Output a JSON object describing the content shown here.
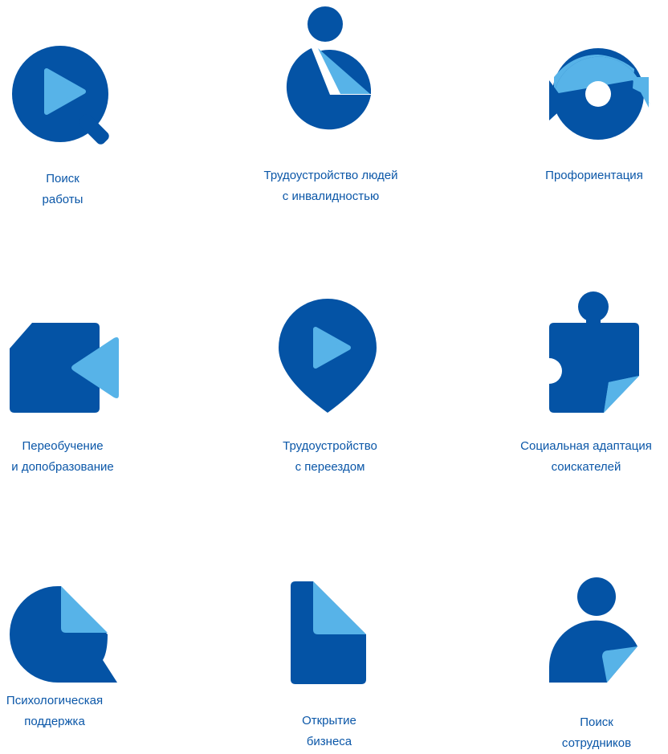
{
  "colors": {
    "primary": "#0453a5",
    "accent": "#57b3e8",
    "label_text": "#0b57a8"
  },
  "services": [
    {
      "id": "job-search",
      "icon": "play-magnifier-icon",
      "label_lines": [
        "Поиск",
        "работы"
      ]
    },
    {
      "id": "disability-employment",
      "icon": "person-pie-icon",
      "label_lines": [
        "Трудоустройство людей",
        "с инвалидностью"
      ]
    },
    {
      "id": "career-guidance",
      "icon": "refresh-cycle-icon",
      "label_lines": [
        "Профориентация"
      ]
    },
    {
      "id": "retraining",
      "icon": "video-camera-icon",
      "label_lines": [
        "Переобучение",
        "и допобразование"
      ]
    },
    {
      "id": "relocation-employment",
      "icon": "location-pin-play-icon",
      "label_lines": [
        "Трудоустройство",
        "с переездом"
      ]
    },
    {
      "id": "social-adaptation",
      "icon": "puzzle-piece-icon",
      "label_lines": [
        "Социальная адаптация",
        "соискателей"
      ]
    },
    {
      "id": "psychological-support",
      "icon": "speech-bubble-icon",
      "label_lines": [
        "Психологическая",
        "поддержка"
      ]
    },
    {
      "id": "business-opening",
      "icon": "document-icon",
      "label_lines": [
        "Открытие",
        "бизнеса"
      ]
    },
    {
      "id": "employee-search",
      "icon": "person-document-icon",
      "label_lines": [
        "Поиск",
        "сотрудников"
      ]
    }
  ]
}
